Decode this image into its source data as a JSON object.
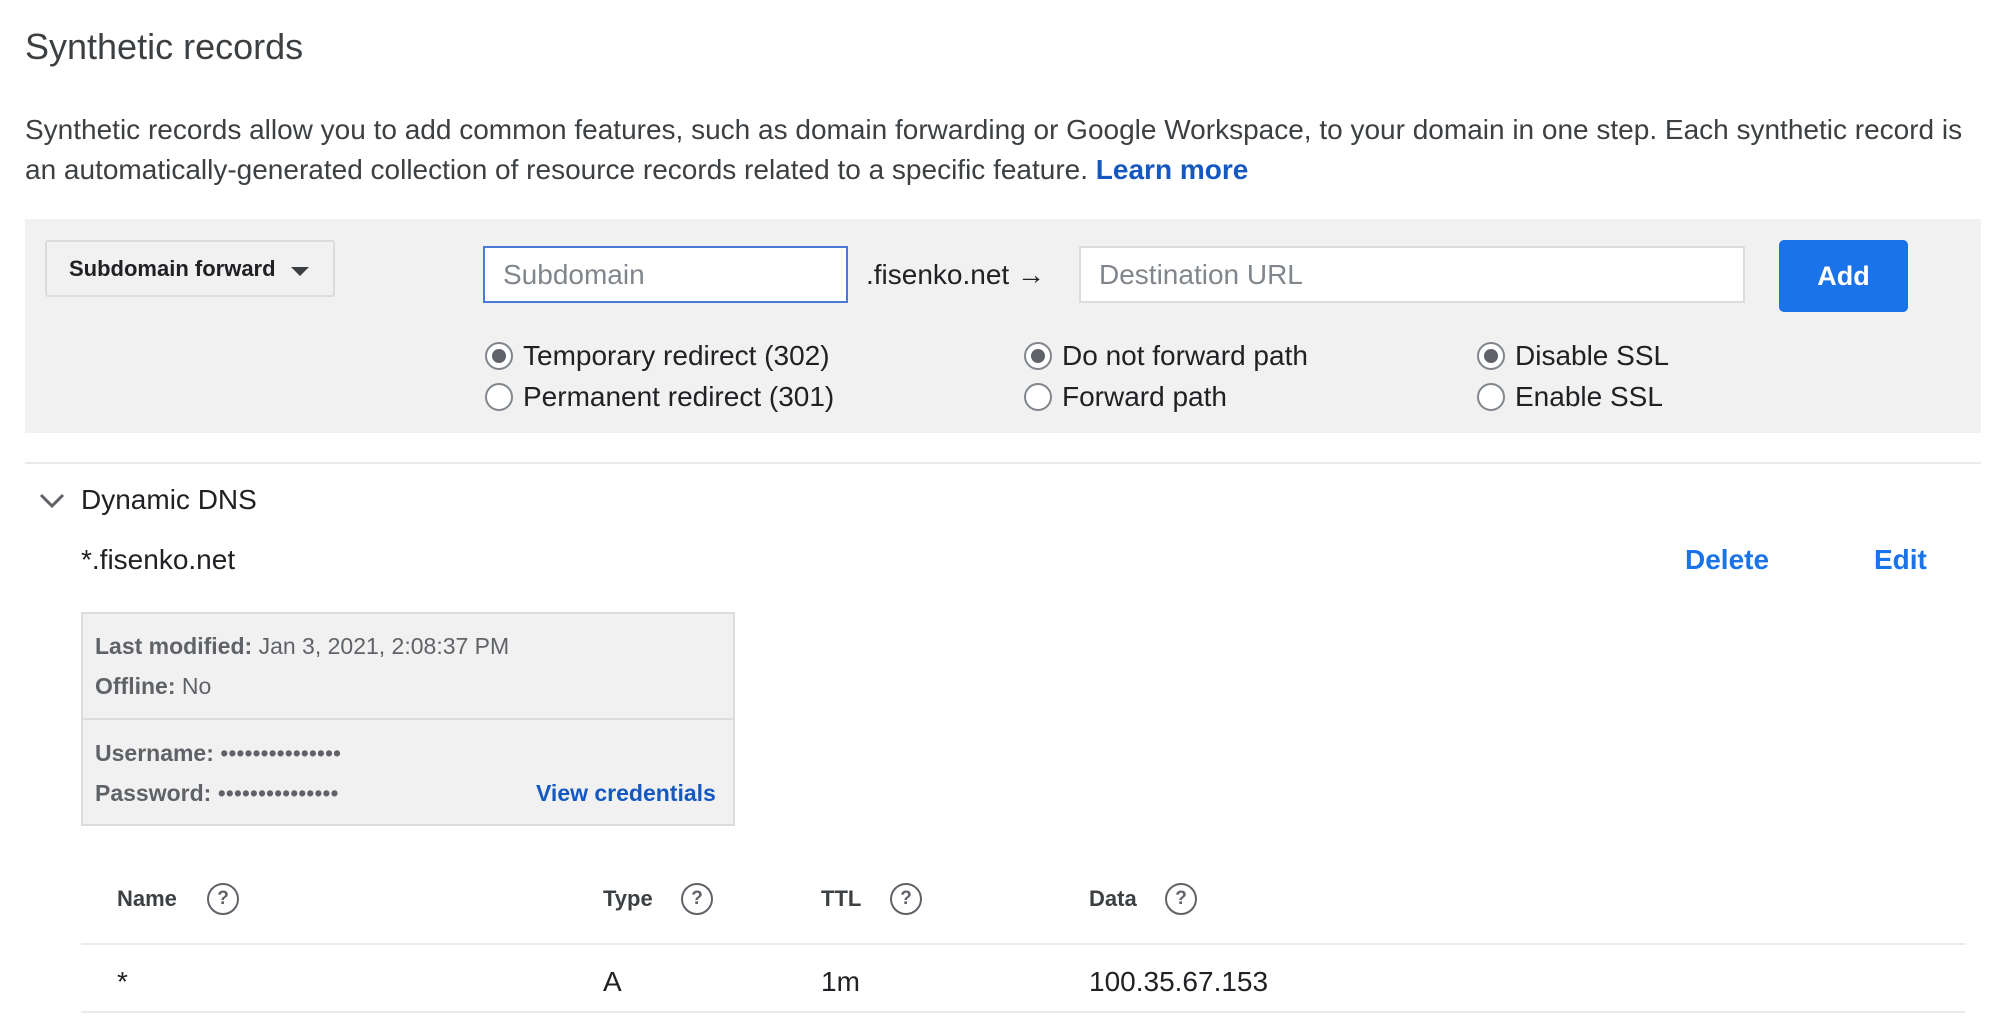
{
  "page": {
    "title": "Synthetic records",
    "intro_text": "Synthetic records allow you to add common features, such as domain forwarding or Google Workspace, to your domain in one step. Each synthetic record is an automatically-generated collection of resource records related to a specific feature.",
    "learn_more": "Learn more"
  },
  "form": {
    "record_type": "Subdomain forward",
    "subdomain_placeholder": "Subdomain",
    "domain_suffix": ".fisenko.net",
    "arrow": "→",
    "destination_placeholder": "Destination URL",
    "add_label": "Add",
    "redirect_options": [
      {
        "label": "Temporary redirect (302)",
        "checked": true
      },
      {
        "label": "Permanent redirect (301)",
        "checked": false
      }
    ],
    "path_options": [
      {
        "label": "Do not forward path",
        "checked": true
      },
      {
        "label": "Forward path",
        "checked": false
      }
    ],
    "ssl_options": [
      {
        "label": "Disable SSL",
        "checked": true
      },
      {
        "label": "Enable SSL",
        "checked": false
      }
    ]
  },
  "record": {
    "type_label": "Dynamic DNS",
    "host": "*.fisenko.net",
    "delete_label": "Delete",
    "edit_label": "Edit",
    "info": {
      "last_modified_label": "Last modified:",
      "last_modified_value": "Jan 3, 2021, 2:08:37 PM",
      "offline_label": "Offline:",
      "offline_value": "No",
      "username_label": "Username:",
      "username_value": "•••••••••••••••",
      "password_label": "Password:",
      "password_value": "•••••••••••••••",
      "view_credentials": "View credentials"
    },
    "table": {
      "headers": [
        "Name",
        "Type",
        "TTL",
        "Data"
      ],
      "help_glyph": "?",
      "rows": [
        {
          "name": "*",
          "type": "A",
          "ttl": "1m",
          "data": "100.35.67.153"
        }
      ]
    }
  },
  "colors": {
    "accent": "#1a73e8",
    "link": "#1558c0",
    "panel": "#f1f1f1"
  }
}
